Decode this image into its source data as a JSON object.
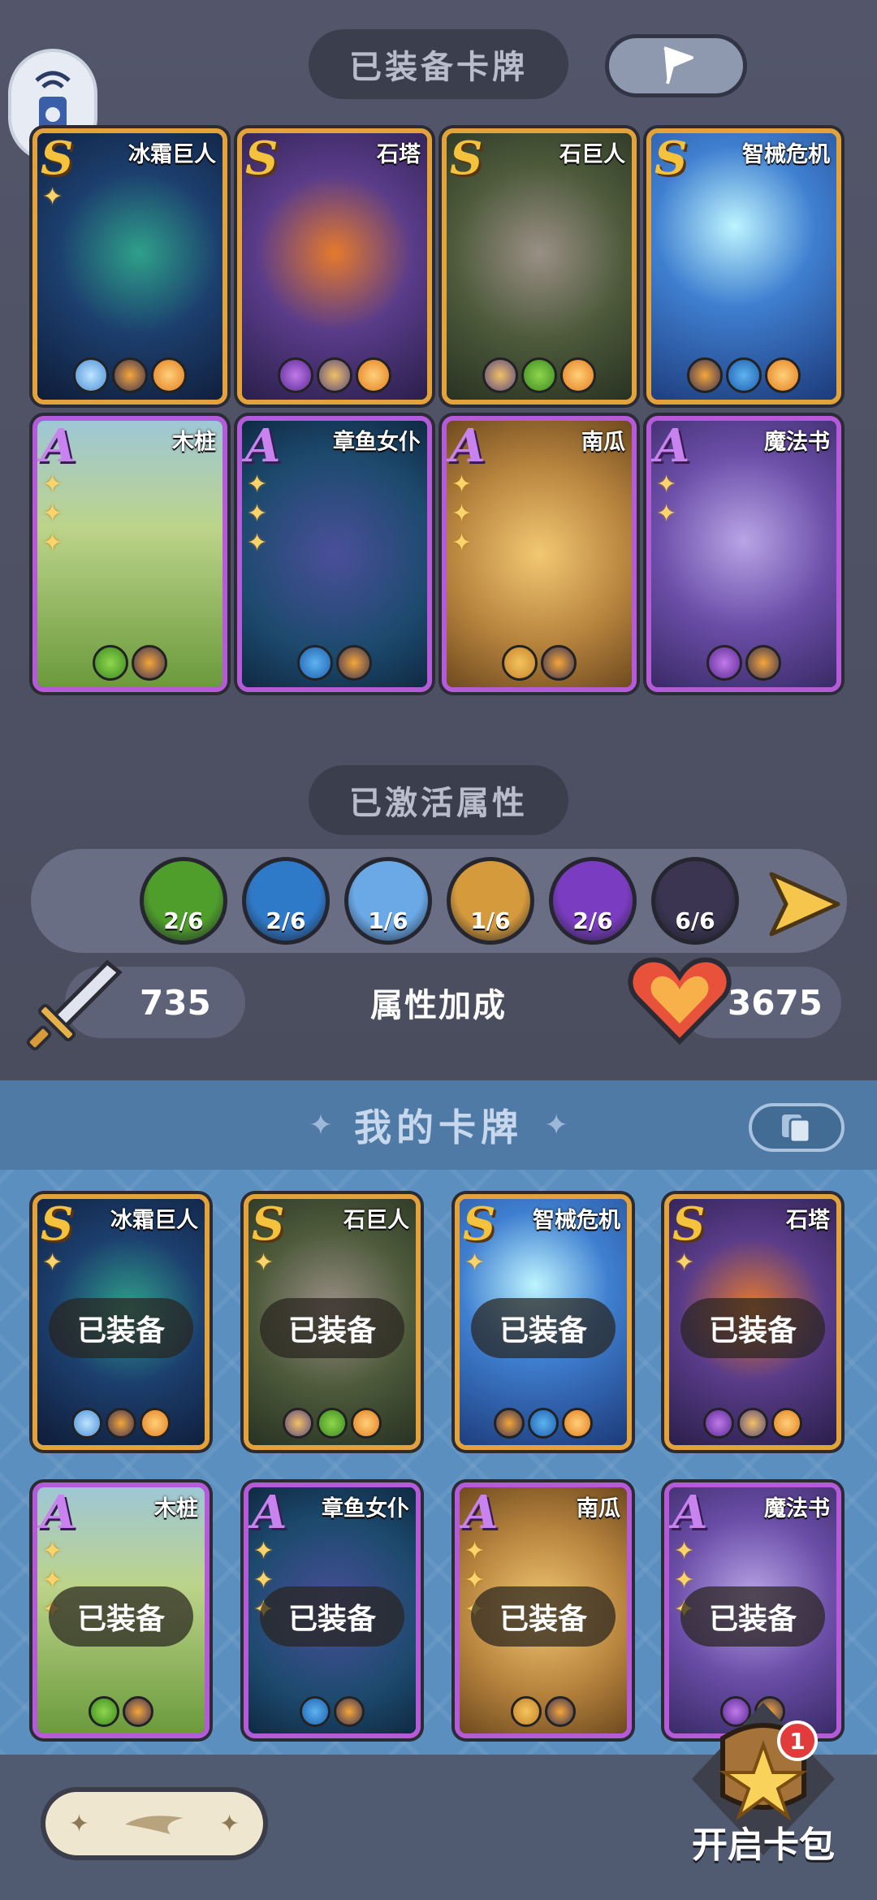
{
  "header": {
    "equipped_title": "已装备卡牌",
    "activated_title": "已激活属性",
    "bonus_label": "属性加成",
    "my_cards_title": "我的卡牌"
  },
  "stats": {
    "attack": "735",
    "health": "3675"
  },
  "attributes": [
    {
      "icon": "grass-icon",
      "count": "2/6",
      "color": "#4f9e2c"
    },
    {
      "icon": "water-wave-icon",
      "count": "2/6",
      "color": "#2f79c9"
    },
    {
      "icon": "ice-crystal-icon",
      "count": "1/6",
      "color": "#6aa8e6"
    },
    {
      "icon": "cactus-icon",
      "count": "1/6",
      "color": "#d59a3c"
    },
    {
      "icon": "vortex-icon",
      "count": "2/6",
      "color": "#7a3cc0"
    },
    {
      "icon": "fire-swirl-icon",
      "count": "6/6",
      "color": "#3b3552"
    }
  ],
  "equipped_cards": [
    {
      "name": "冰霜巨人",
      "rank": "S",
      "stars": 1
    },
    {
      "name": "石塔",
      "rank": "S",
      "stars": 0
    },
    {
      "name": "石巨人",
      "rank": "S",
      "stars": 0
    },
    {
      "name": "智械危机",
      "rank": "S",
      "stars": 0
    },
    {
      "name": "木桩",
      "rank": "A",
      "stars": 3
    },
    {
      "name": "章鱼女仆",
      "rank": "A",
      "stars": 3
    },
    {
      "name": "南瓜",
      "rank": "A",
      "stars": 3
    },
    {
      "name": "魔法书",
      "rank": "A",
      "stars": 2
    }
  ],
  "my_cards": [
    {
      "name": "冰霜巨人",
      "rank": "S",
      "status": "已装备"
    },
    {
      "name": "石巨人",
      "rank": "S",
      "status": "已装备"
    },
    {
      "name": "智械危机",
      "rank": "S",
      "status": "已装备"
    },
    {
      "name": "石塔",
      "rank": "S",
      "status": "已装备"
    },
    {
      "name": "木桩",
      "rank": "A",
      "status": "已装备"
    },
    {
      "name": "章鱼女仆",
      "rank": "A",
      "status": "已装备"
    },
    {
      "name": "南瓜",
      "rank": "A",
      "status": "已装备"
    },
    {
      "name": "魔法书",
      "rank": "A",
      "status": "已装备"
    }
  ],
  "open_pack": {
    "label": "开启卡包",
    "badge": "1"
  }
}
